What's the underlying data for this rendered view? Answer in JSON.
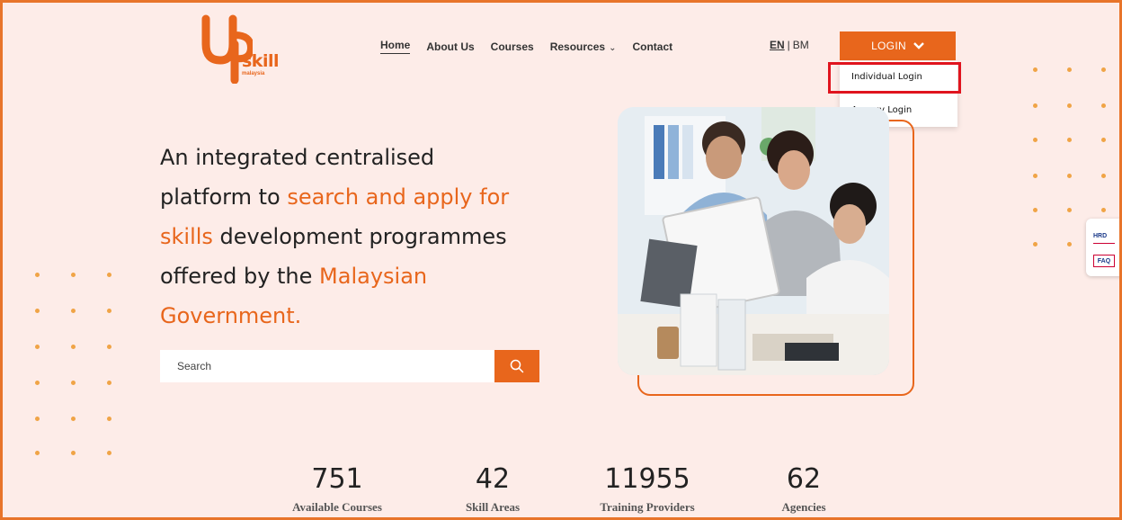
{
  "brand": {
    "logo_word": "skill",
    "logo_sub": "malaysia",
    "accent_color": "#e8661c",
    "highlight_color": "#e0141e"
  },
  "nav": {
    "items": [
      {
        "label": "Home"
      },
      {
        "label": "About Us"
      },
      {
        "label": "Courses"
      },
      {
        "label": "Resources"
      },
      {
        "label": "Contact"
      }
    ]
  },
  "lang": {
    "en": "EN",
    "sep": "|",
    "bm": "BM"
  },
  "login": {
    "label": "LOGIN",
    "options": [
      {
        "label": "Individual Login"
      },
      {
        "label": "Agency Login"
      }
    ]
  },
  "hero": {
    "t1": "An integrated centralised",
    "t2": "platform to ",
    "a1": "search and apply for",
    "a2": "skills",
    "t3": " development programmes",
    "t4": "offered by the ",
    "a3": "Malaysian",
    "a4": "Government."
  },
  "search": {
    "placeholder": "Search",
    "icon": "search-icon"
  },
  "stats": [
    {
      "value": "751",
      "label": "Available Courses"
    },
    {
      "value": "42",
      "label": "Skill Areas"
    },
    {
      "value": "11955",
      "label": "Training Providers"
    },
    {
      "value": "62",
      "label": "Agencies"
    }
  ],
  "side_widget": {
    "hrd": "HRD",
    "faq": "FAQ"
  }
}
